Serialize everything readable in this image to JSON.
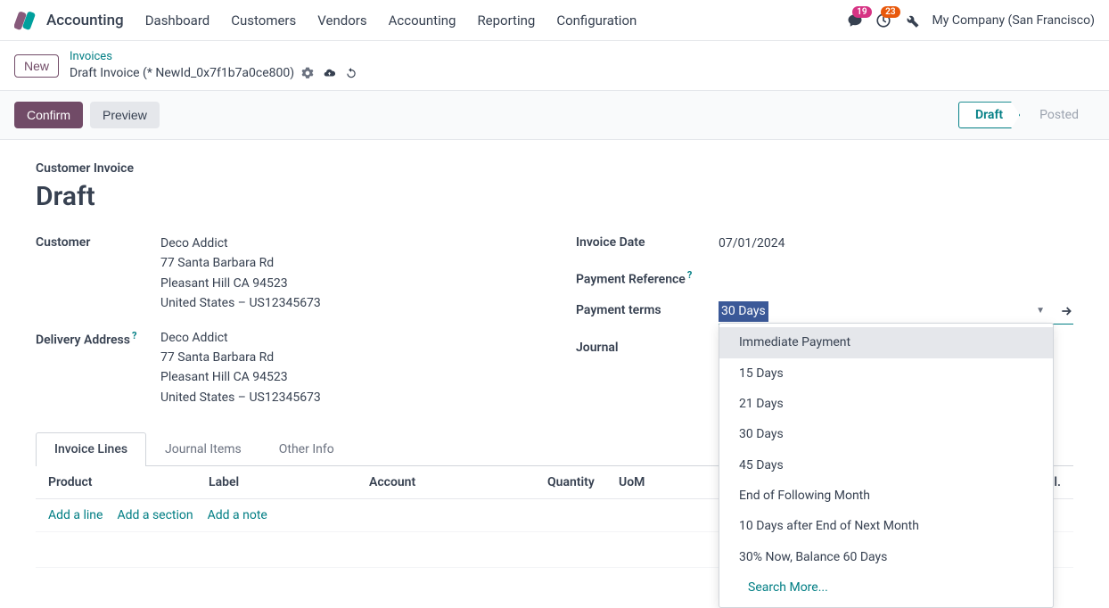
{
  "app": {
    "name": "Accounting"
  },
  "nav": {
    "items": [
      "Dashboard",
      "Customers",
      "Vendors",
      "Accounting",
      "Reporting",
      "Configuration"
    ]
  },
  "topright": {
    "msg_badge": "19",
    "activity_badge": "23",
    "company": "My Company (San Francisco)"
  },
  "breadcrumb": {
    "new_label": "New",
    "parent": "Invoices",
    "current": "Draft Invoice (* NewId_0x7f1b7a0ce800)"
  },
  "actions": {
    "confirm": "Confirm",
    "preview": "Preview"
  },
  "status": {
    "draft": "Draft",
    "posted": "Posted"
  },
  "form": {
    "subtitle": "Customer Invoice",
    "title": "Draft",
    "customer_label": "Customer",
    "customer": {
      "name": "Deco Addict",
      "street": "77 Santa Barbara Rd",
      "city": "Pleasant Hill CA 94523",
      "country": "United States – US12345673"
    },
    "delivery_label": "Delivery Address",
    "delivery": {
      "name": "Deco Addict",
      "street": "77 Santa Barbara Rd",
      "city": "Pleasant Hill CA 94523",
      "country": "United States – US12345673"
    },
    "invoice_date_label": "Invoice Date",
    "invoice_date": "07/01/2024",
    "payref_label": "Payment Reference",
    "terms_label": "Payment terms",
    "terms_value": "30 Days",
    "journal_label": "Journal"
  },
  "dropdown": {
    "options": [
      "Immediate Payment",
      "15 Days",
      "21 Days",
      "30 Days",
      "45 Days",
      "End of Following Month",
      "10 Days after End of Next Month",
      "30% Now, Balance 60 Days"
    ],
    "search_more": "Search More..."
  },
  "tabs": {
    "items": [
      "Invoice Lines",
      "Journal Items",
      "Other Info"
    ]
  },
  "table": {
    "headers": {
      "product": "Product",
      "label": "Label",
      "account": "Account",
      "quantity": "Quantity",
      "uom": "UoM",
      "tax": "Tax excl."
    },
    "add_line": "Add a line",
    "add_section": "Add a section",
    "add_note": "Add a note"
  }
}
